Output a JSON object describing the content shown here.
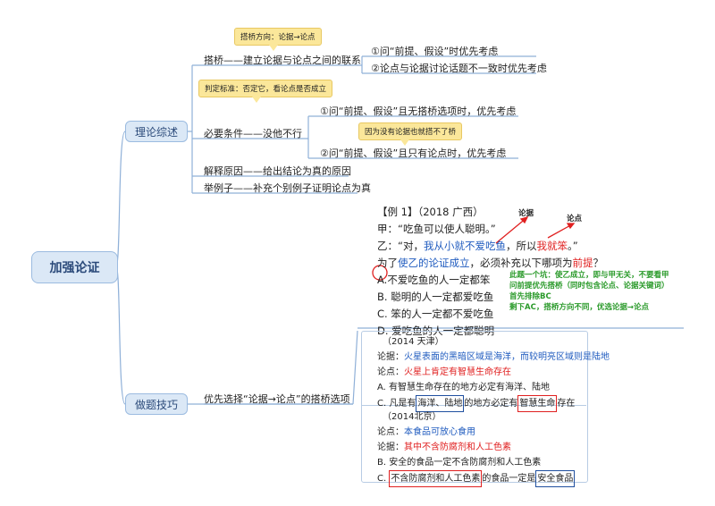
{
  "root": "加强论证",
  "branches": {
    "theory": "理论综述",
    "skills": "做题技巧"
  },
  "theory": {
    "bridge": "搭桥——建立论据与论点之间的联系",
    "bridge_note": "搭桥方向：论据→论点",
    "bridge_children": [
      "①问“前提、假设”时优先考虑",
      "②论点与论据讨论话题不一致时优先考虑"
    ],
    "necessary": "必要条件——没他不行",
    "necessary_note": "判定标准：否定它，看论点是否成立",
    "necessary_children": [
      "①问“前提、假设”且无搭桥选项时，优先考虑",
      "②问“前提、假设”且只有论点时，优先考虑"
    ],
    "necessary_child_note": "因为没有论据也就搭不了桥",
    "explain": "解释原因——给出结论为真的原因",
    "example": "举例子——补充个别例子证明论点为真"
  },
  "skills": {
    "prefer": "优先选择“论据→论点”的搭桥选项",
    "ex1": {
      "title": "【例 1】（2018 广西）",
      "jia": "甲：“吃鱼可以使人聪明。”",
      "yi_pre": "乙：“对，",
      "yi_blue": "我从小就不爱吃鱼",
      "yi_mid": "，所以",
      "yi_red": "我就笨",
      "yi_end": "。”",
      "q_pre": "为了",
      "q_blue": "使乙的论证成立",
      "q_mid": "，必须补充以下哪项为",
      "q_red": "前提",
      "q_end": "？",
      "arrow_label_1": "论据",
      "arrow_label_2": "论点",
      "options": [
        {
          "letter": "A.",
          "text": "不爱吃鱼的人一定都笨"
        },
        {
          "letter": "B.",
          "text": "聪明的人一定都爱吃鱼"
        },
        {
          "letter": "C.",
          "text": "笨的人一定都不爱吃鱼"
        },
        {
          "letter": "D.",
          "text": "爱吃鱼的人一定都聪明"
        }
      ],
      "notes": [
        "此题一个坑：使乙成立，即与甲无关，不要看甲",
        "问前提优先搭桥（同时包含论点、论据关键词）",
        "首先排除BC",
        "剩下AC，搭桥方向不同，优选论据→论点"
      ]
    },
    "ex2": {
      "title": "（2014 天津）",
      "arg_label": "论据：",
      "arg": "火星表面的黑暗区域是海洋，而较明亮区域则是陆地",
      "claim_label": "论点：",
      "claim": "火星上肯定有智慧生命存在",
      "a": "A. 有智慧生命存在的地方必定有海洋、陆地",
      "c_pre": "C. 凡是有",
      "c_box1": "海洋、陆地",
      "c_mid": "的地方必定有",
      "c_box2": "智慧生命",
      "c_end": "存在"
    },
    "ex3": {
      "title": "（2014北京）",
      "claim_label": "论点：",
      "claim": "本食品可放心食用",
      "arg_label": "论据：",
      "arg": "其中不含防腐剂和人工色素",
      "b": "B. 安全的食品一定不含防腐剂和人工色素",
      "c_pre": "C. ",
      "c_box1": "不含防腐剂和人工色素",
      "c_mid": "的食品一定是",
      "c_box2": "安全食品"
    }
  }
}
